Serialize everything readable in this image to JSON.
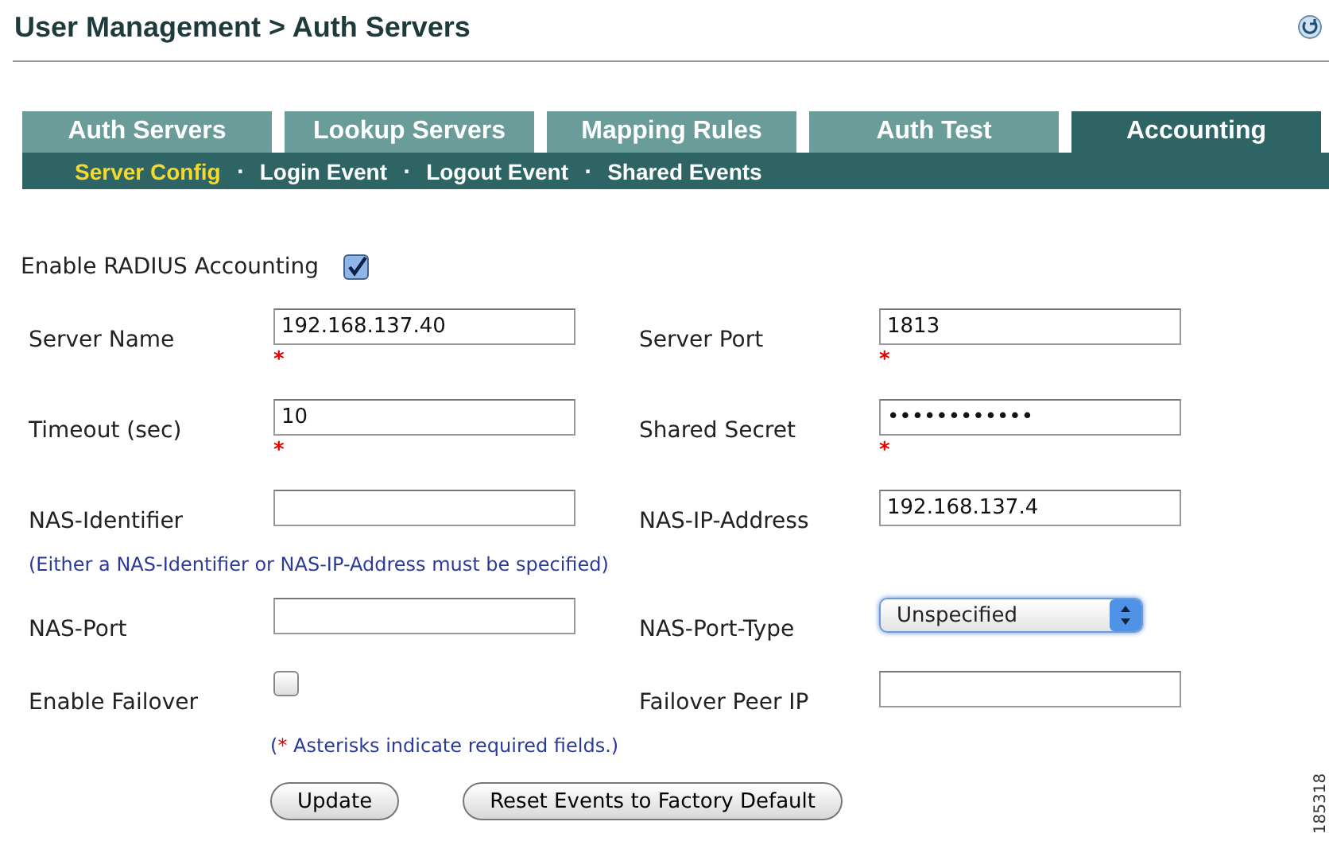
{
  "page_title": "User Management > Auth Servers",
  "tabs": [
    {
      "label": "Auth Servers",
      "selected": false
    },
    {
      "label": "Lookup Servers",
      "selected": false
    },
    {
      "label": "Mapping Rules",
      "selected": false
    },
    {
      "label": "Auth Test",
      "selected": false
    },
    {
      "label": "Accounting",
      "selected": true
    }
  ],
  "subtabs": [
    {
      "label": "Server Config",
      "selected": true
    },
    {
      "label": "Login Event",
      "selected": false
    },
    {
      "label": "Logout Event",
      "selected": false
    },
    {
      "label": "Shared Events",
      "selected": false
    }
  ],
  "subtab_separator": "·",
  "enable_accounting": {
    "label": "Enable RADIUS Accounting",
    "checked": true
  },
  "rows": [
    {
      "kind": "fields",
      "left": {
        "label": "Server Name",
        "kind": "text",
        "value": "192.168.137.40",
        "required": true
      },
      "right": {
        "label": "Server Port",
        "kind": "text",
        "value": "1813",
        "required": true
      }
    },
    {
      "kind": "fields",
      "left": {
        "label": "Timeout (sec)",
        "kind": "text",
        "value": "10",
        "required": true
      },
      "right": {
        "label": "Shared Secret",
        "kind": "text",
        "value": "••••••••••••",
        "required": true
      }
    },
    {
      "kind": "fields",
      "left": {
        "label": "NAS-Identifier",
        "kind": "text",
        "required": false
      },
      "right": {
        "label": "NAS-IP-Address",
        "kind": "text",
        "value": "192.168.137.4",
        "required": false
      }
    },
    {
      "kind": "note",
      "text": "(Either a NAS-Identifier or NAS-IP-Address must be specified)"
    },
    {
      "kind": "fields",
      "left": {
        "label": "NAS-Port",
        "kind": "text",
        "required": false
      },
      "right": {
        "label": "NAS-Port-Type",
        "kind": "select",
        "value": "Unspecified",
        "required": false
      }
    },
    {
      "kind": "fields",
      "left": {
        "label": "Enable Failover",
        "kind": "checkbox",
        "checked": false,
        "required": false
      },
      "right": {
        "label": "Failover Peer IP",
        "kind": "text",
        "required": false
      }
    }
  ],
  "required_mark": "*",
  "required_note": {
    "open": "(",
    "mark": "*",
    "text": "Asterisks indicate required fields.)"
  },
  "buttons": [
    "Update",
    "Reset Events to Factory Default"
  ],
  "figure_id": "185318"
}
